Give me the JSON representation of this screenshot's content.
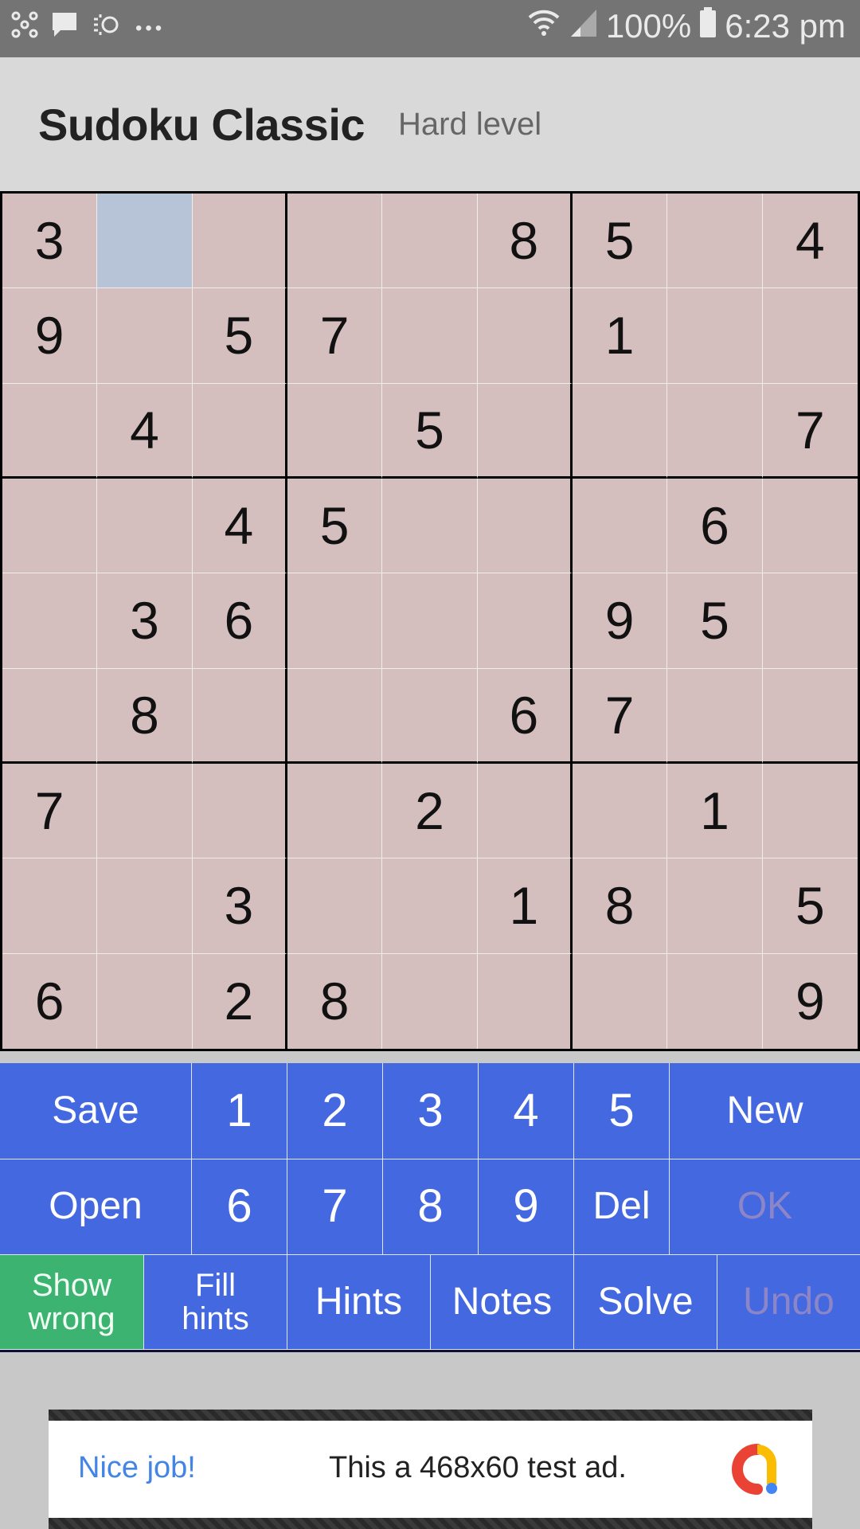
{
  "status_bar": {
    "left_icons": [
      "mesh-network-icon",
      "message-icon",
      "weather-icon",
      "more-dots-icon"
    ],
    "more_dots": "•••",
    "battery_percent": "100%",
    "time": "6:23 pm"
  },
  "app_bar": {
    "title": "Sudoku Classic",
    "level": "Hard level"
  },
  "board": {
    "selected_cell": {
      "row": 0,
      "col": 1
    },
    "rows": [
      [
        "3",
        "",
        "",
        "",
        "",
        "8",
        "5",
        "",
        "4"
      ],
      [
        "9",
        "",
        "5",
        "7",
        "",
        "",
        "1",
        "",
        ""
      ],
      [
        "",
        "4",
        "",
        "",
        "5",
        "",
        "",
        "",
        "7"
      ],
      [
        "",
        "",
        "4",
        "5",
        "",
        "",
        "",
        "6",
        ""
      ],
      [
        "",
        "3",
        "6",
        "",
        "",
        "",
        "9",
        "5",
        ""
      ],
      [
        "",
        "8",
        "",
        "",
        "",
        "6",
        "7",
        "",
        ""
      ],
      [
        "7",
        "",
        "",
        "",
        "2",
        "",
        "",
        "1",
        ""
      ],
      [
        "",
        "",
        "3",
        "",
        "",
        "1",
        "8",
        "",
        "5"
      ],
      [
        "6",
        "",
        "2",
        "8",
        "",
        "",
        "",
        "",
        "9"
      ]
    ]
  },
  "keypad": {
    "row1": {
      "save": "Save",
      "numbers": [
        "1",
        "2",
        "3",
        "4",
        "5"
      ],
      "new": "New"
    },
    "row2": {
      "open": "Open",
      "numbers": [
        "6",
        "7",
        "8",
        "9"
      ],
      "del": "Del",
      "ok": "OK"
    },
    "row3": {
      "show_wrong": [
        "Show",
        "wrong"
      ],
      "fill_hints": [
        "Fill",
        "hints"
      ],
      "hints": "Hints",
      "notes": "Notes",
      "solve": "Solve",
      "undo": "Undo"
    },
    "colors": {
      "primary": "#4468e0",
      "active": "#3cb371",
      "disabled_text": "#8c86c8"
    }
  },
  "ad": {
    "left_text": "Nice job!",
    "main_text": "This a 468x60 test ad."
  }
}
